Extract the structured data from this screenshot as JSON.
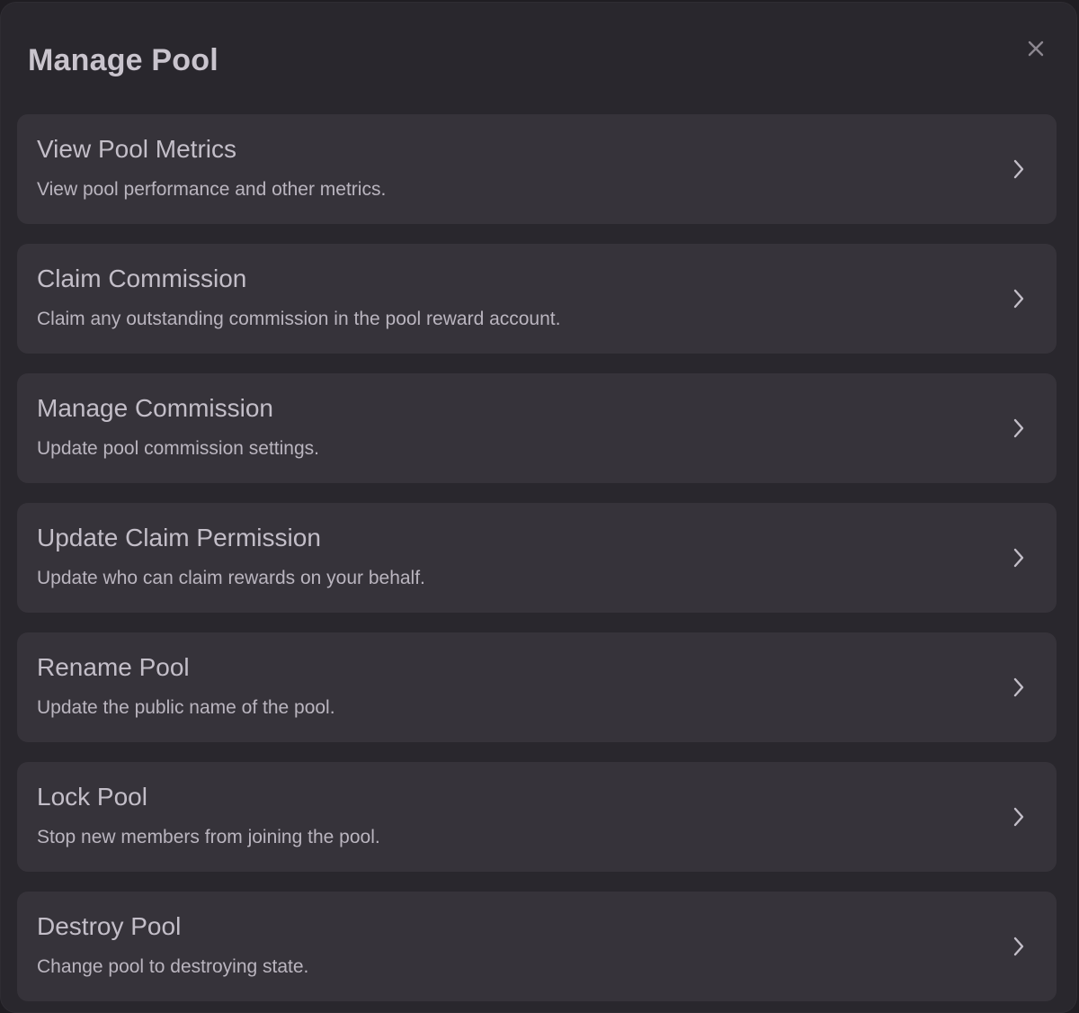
{
  "modal": {
    "title": "Manage Pool",
    "close_icon": "close-icon",
    "chevron_icon": "chevron-right-icon"
  },
  "colors": {
    "background": "#1f1d22",
    "modal": "#29272d",
    "card": "#36333a",
    "title_text": "#c9c4cd",
    "card_text": "#c3bec8"
  },
  "options": [
    {
      "title": "View Pool Metrics",
      "description": "View pool performance and other metrics."
    },
    {
      "title": "Claim Commission",
      "description": "Claim any outstanding commission in the pool reward account."
    },
    {
      "title": "Manage Commission",
      "description": "Update pool commission settings."
    },
    {
      "title": "Update Claim Permission",
      "description": "Update who can claim rewards on your behalf."
    },
    {
      "title": "Rename Pool",
      "description": "Update the public name of the pool."
    },
    {
      "title": "Lock Pool",
      "description": "Stop new members from joining the pool."
    },
    {
      "title": "Destroy Pool",
      "description": "Change pool to destroying state."
    }
  ]
}
